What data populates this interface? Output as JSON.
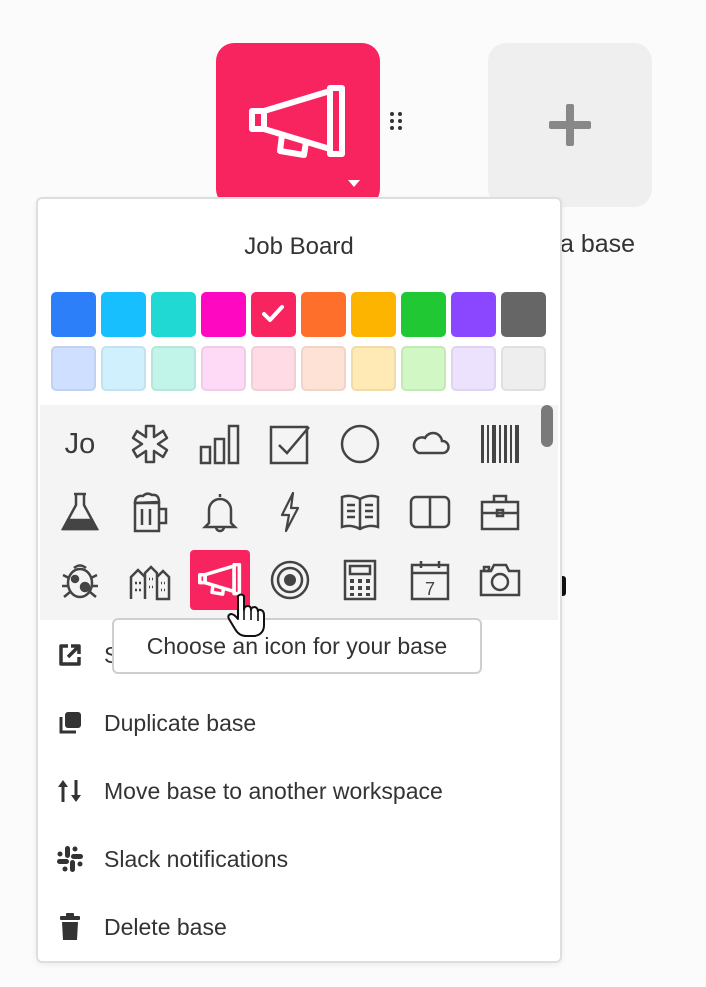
{
  "base": {
    "name": "Job Board",
    "color": "#f7245f",
    "icon": "megaphone-icon"
  },
  "add_base": {
    "label": "a base",
    "icon": "plus-icon"
  },
  "palette": {
    "selected_color": "#f7245f",
    "row1": [
      "#2d7ff9",
      "#18bfff",
      "#20d9d2",
      "#ff08c2",
      "#f7245f",
      "#ff6f2c",
      "#fcb400",
      "#20c933",
      "#8b46ff",
      "#666666"
    ],
    "row2": [
      "#cfdfff",
      "#d0f0fd",
      "#c2f5e9",
      "#ffdaf6",
      "#ffdce5",
      "#fee2d5",
      "#ffeab6",
      "#d1f7c4",
      "#ede2fe",
      "#eeeeee"
    ]
  },
  "icon_picker": {
    "rows": [
      [
        "Jo",
        "asterisk-icon",
        "bar-chart-icon",
        "checkbox-icon",
        "circle-icon",
        "cloud-icon",
        "barcode-icon"
      ],
      [
        "flask-icon",
        "beer-mug-icon",
        "bell-icon",
        "lightning-icon",
        "book-open-icon",
        "book-closed-icon",
        "briefcase-icon"
      ],
      [
        "bug-icon",
        "buildings-icon",
        "megaphone-icon",
        "target-icon",
        "calculator-icon",
        "calendar-icon",
        "camera-icon"
      ]
    ],
    "text_tile": "Jo",
    "calendar_day": "7",
    "selected_icon": "megaphone-icon"
  },
  "tooltip": {
    "text": "Choose an icon for your base"
  },
  "menu_items": [
    {
      "label": "S",
      "icon": "share-external-icon"
    },
    {
      "label": "Duplicate base",
      "icon": "duplicate-icon"
    },
    {
      "label": "Move base to another workspace",
      "icon": "move-arrows-icon"
    },
    {
      "label": "Slack notifications",
      "icon": "slack-icon"
    },
    {
      "label": "Delete base",
      "icon": "trash-icon"
    }
  ]
}
